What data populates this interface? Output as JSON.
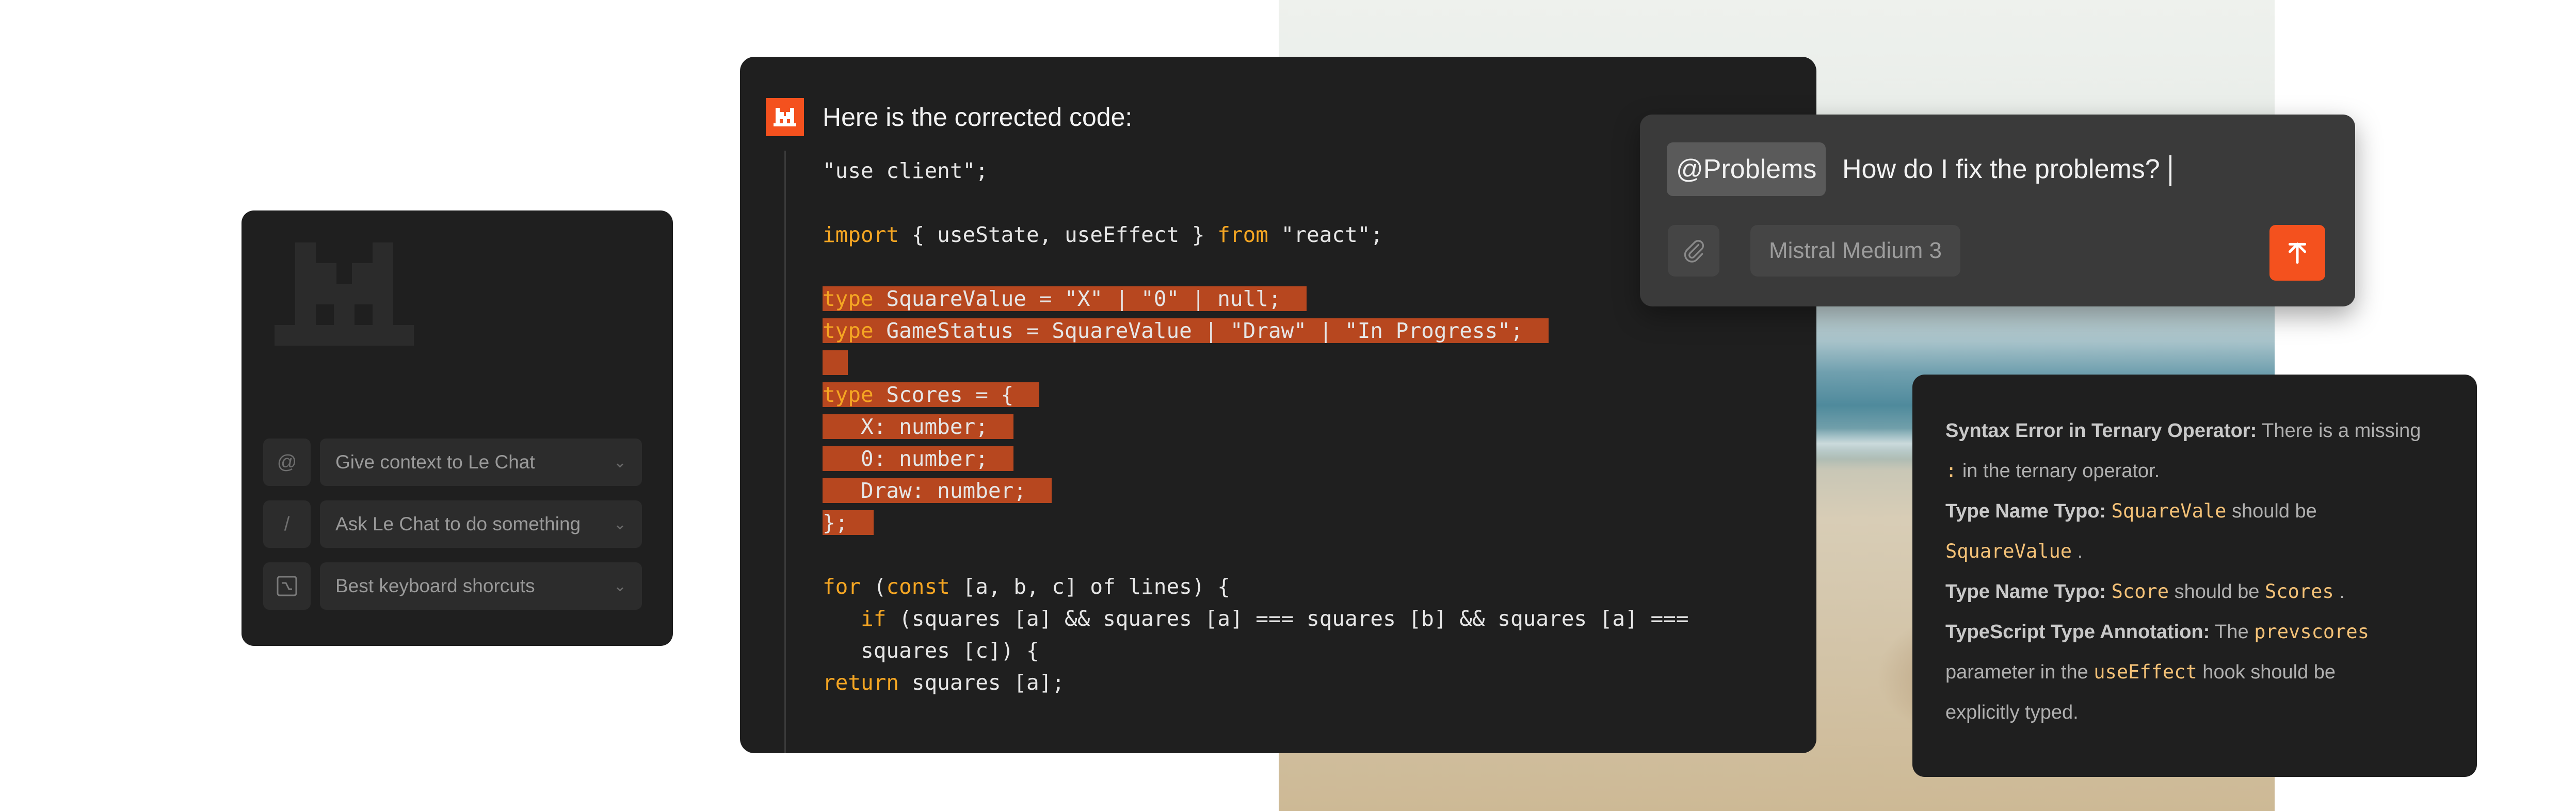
{
  "quick_actions": [
    {
      "key": "@",
      "label": "Give context to Le Chat"
    },
    {
      "key": "/",
      "label": "Ask Le Chat to do something"
    },
    {
      "key": "⌥",
      "label": "Best keyboard shorcuts"
    }
  ],
  "chat": {
    "heading": "Here is the corrected code:",
    "code": {
      "l1": "\"use client\";",
      "l3_kw": "import",
      "l3_a": " { useState, useEffect } ",
      "l3_kw2": "from",
      "l3_b": " \"react\";",
      "l5_kw": "type",
      "l5_b": " SquareValue = \"X\" | \"0\" | null;",
      "l6_kw": "type",
      "l6_b": " GameStatus = SquareValue | \"Draw\" | \"In Progress\";",
      "l8_kw": "type",
      "l8_b": " Scores = {",
      "l9": "   X: number;",
      "l10": "   0: number;",
      "l11": "   Draw: number;",
      "l12": "};",
      "l14_kw": "for",
      "l14_a": " (",
      "l14_kw2": "const",
      "l14_b": " [a, b, c] of lines) {",
      "l15_pre": "   ",
      "l15_kw": "if",
      "l15_b": " (squares [a] && squares [a] === squares [b] && squares [a] ===",
      "l16": "   squares [c]) {",
      "l17_kw": "return",
      "l17_b": " squares [a];"
    }
  },
  "prompt": {
    "mention": "@Problems",
    "question": "How do I fix the problems?",
    "model": "Mistral Medium 3"
  },
  "problems": {
    "p1_title": "Syntax Error in Ternary Operator:",
    "p1_text": " There is a missing",
    "p1_code": ":",
    "p1_text2": " in the ternary operator.",
    "p2_title": "Type Name Typo:",
    "p2_code1": "SquareVale",
    "p2_text": " should be",
    "p2_code2": "SquareValue",
    "p2_text2": " .",
    "p3_title": "Type Name Typo:",
    "p3_code1": "Score",
    "p3_text": " should be ",
    "p3_code2": "Scores",
    "p3_text2": " .",
    "p4_title": "TypeScript Type Annotation:",
    "p4_text": " The ",
    "p4_code1": "prevscores",
    "p4_text2": "parameter in the ",
    "p4_code2": "useEffect",
    "p4_text3": "  hook should be",
    "p4_text4": "explicitly typed."
  },
  "colors": {
    "accent": "#f4511e",
    "highlight": "#b7471f",
    "keyword": "#f5a623",
    "card_bg": "#1f1f1f"
  }
}
